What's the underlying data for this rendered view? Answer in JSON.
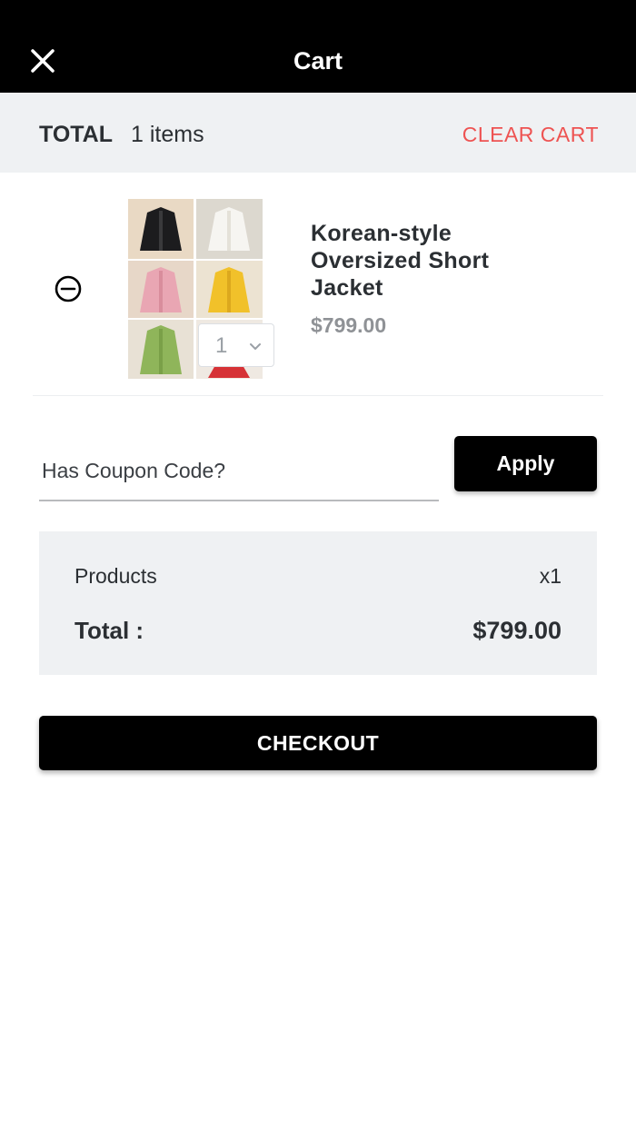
{
  "header": {
    "title": "Cart",
    "close_icon": "close-icon"
  },
  "total_bar": {
    "total_label": "TOTAL",
    "items_count": "1 items",
    "clear_cart_label": "CLEAR CART"
  },
  "cart": {
    "items": [
      {
        "name": "Korean-style Oversized Short Jacket",
        "price": "$799.00",
        "quantity": "1",
        "remove_icon": "minus-circle-icon",
        "thumbnail_colors": [
          "#1c1c1e",
          "#f2f1ec",
          "#e9a6b3",
          "#f1c12a",
          "#8fb55a",
          "#d63236"
        ]
      }
    ]
  },
  "coupon": {
    "placeholder": "Has Coupon Code?",
    "value": "",
    "apply_label": "Apply"
  },
  "summary": {
    "products_label": "Products",
    "products_qty": "x1",
    "total_label": "Total :",
    "total_value": "$799.00"
  },
  "checkout": {
    "label": "CHECKOUT"
  },
  "colors": {
    "header_bg": "#000000",
    "panel_bg": "#eff1f3",
    "accent_red": "#ee5352",
    "text_dark": "#2b2f33",
    "price_gray": "#8f9296"
  }
}
